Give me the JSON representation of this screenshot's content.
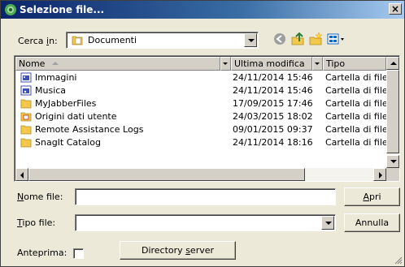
{
  "window": {
    "title": "Selezione file...",
    "close_glyph": "×"
  },
  "lookin": {
    "label_pre": "Cerca ",
    "label_acc": "i",
    "label_post": "n:",
    "value": "Documenti"
  },
  "toolbar": {
    "back_icon": "back-circle-icon",
    "up_icon": "up-folder-icon",
    "newfolder_icon": "new-folder-icon",
    "view_icon": "view-menu-icon"
  },
  "columns": {
    "name": "Nome",
    "modified": "Ultima modifica",
    "type": "Tipo"
  },
  "files": [
    {
      "name": "Immagini",
      "modified": "24/11/2014 15:46",
      "type": "Cartella di file",
      "icon": "pictures-folder-icon"
    },
    {
      "name": "Musica",
      "modified": "24/11/2014 15:46",
      "type": "Cartella di file",
      "icon": "music-folder-icon"
    },
    {
      "name": "MyJabberFiles",
      "modified": "17/09/2015 17:46",
      "type": "Cartella di file",
      "icon": "folder-icon"
    },
    {
      "name": "Origini dati utente",
      "modified": "24/03/2015 18:02",
      "type": "Cartella di file",
      "icon": "data-sources-folder-icon"
    },
    {
      "name": "Remote Assistance Logs",
      "modified": "09/01/2015 09:37",
      "type": "Cartella di file",
      "icon": "folder-icon"
    },
    {
      "name": "SnagIt Catalog",
      "modified": "24/11/2014 18:16",
      "type": "Cartella di file",
      "icon": "folder-icon"
    }
  ],
  "filename": {
    "label_acc": "N",
    "label_post": "ome file:",
    "value": ""
  },
  "filetype": {
    "label_acc": "T",
    "label_post": "ipo file:",
    "value": ""
  },
  "buttons": {
    "open_acc": "A",
    "open_post": "pri",
    "cancel": "Annulla",
    "directory_pre": "Directory ",
    "directory_acc": "s",
    "directory_post": "erver"
  },
  "preview": {
    "label": "Anteprima:",
    "checked": false
  },
  "colors": {
    "dialog_bg": "#ece9d8",
    "title_start": "#0a246a",
    "title_end": "#a6caf0",
    "folder": "#f2c94c"
  }
}
